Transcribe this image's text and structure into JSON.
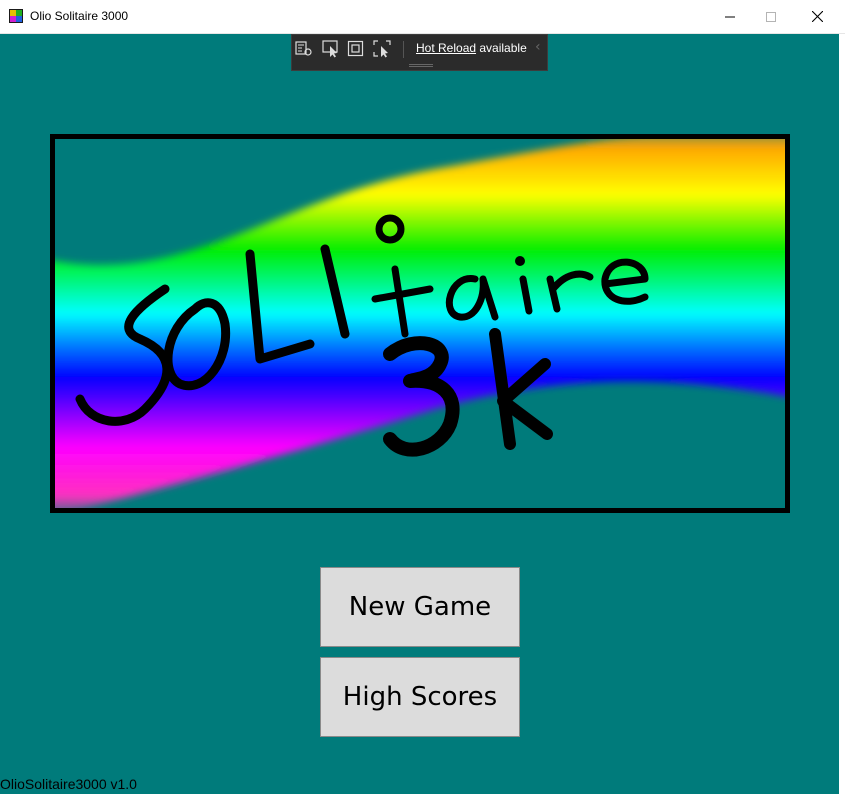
{
  "window": {
    "title": "Olio Solitaire 3000",
    "icon": "app-cards-icon",
    "controls": [
      "minimize-icon",
      "maximize-icon",
      "close-icon"
    ]
  },
  "dev_toolbar": {
    "tools": [
      "live-visual-tree-icon",
      "select-element-icon",
      "display-layout-adorners-icon",
      "track-focus-icon"
    ],
    "hot_reload_link": "Hot Reload",
    "hot_reload_status": " available"
  },
  "logo": {
    "line1": "SOLItaire",
    "line2": "3k",
    "colors": {
      "border": "#000000",
      "background": "#007B7B"
    }
  },
  "menu": {
    "new_game": "New Game",
    "high_scores": "High Scores"
  },
  "footer": {
    "version": "OlioSolitaire3000 v1.0"
  },
  "colors": {
    "background": "#007B7B",
    "button": "#dcdcdc"
  }
}
